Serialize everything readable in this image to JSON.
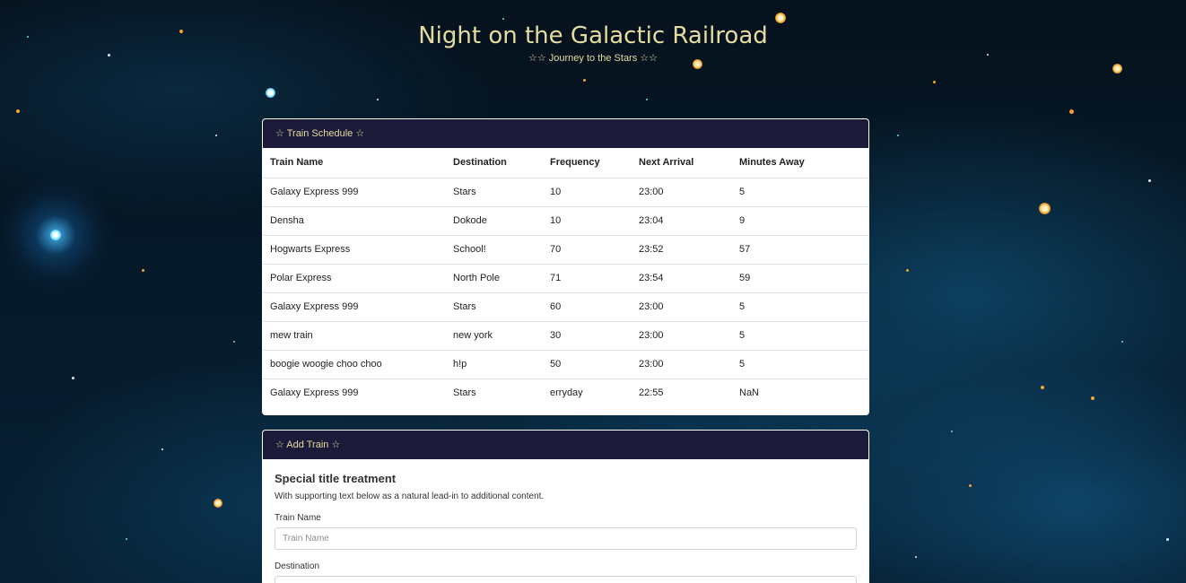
{
  "header": {
    "title": "Night on the Galactic Railroad",
    "subtitle": "☆☆ Journey to the Stars ☆☆"
  },
  "schedule": {
    "header": "☆ Train Schedule ☆",
    "columns": [
      "Train Name",
      "Destination",
      "Frequency",
      "Next Arrival",
      "Minutes Away"
    ],
    "rows": [
      [
        "Galaxy Express 999",
        "Stars",
        "10",
        "23:00",
        "5"
      ],
      [
        "Densha",
        "Dokode",
        "10",
        "23:04",
        "9"
      ],
      [
        "Hogwarts Express",
        "School!",
        "70",
        "23:52",
        "57"
      ],
      [
        "Polar Express",
        "North Pole",
        "71",
        "23:54",
        "59"
      ],
      [
        "Galaxy Express 999",
        "Stars",
        "60",
        "23:00",
        "5"
      ],
      [
        "mew train",
        "new york",
        "30",
        "23:00",
        "5"
      ],
      [
        "boogie woogie choo choo",
        "h!p",
        "50",
        "23:00",
        "5"
      ],
      [
        "Galaxy Express 999",
        "Stars",
        "erryday",
        "22:55",
        "NaN"
      ]
    ]
  },
  "add_train": {
    "header": "☆ Add Train ☆",
    "title": "Special title treatment",
    "text": "With supporting text below as a natural lead-in to additional content.",
    "train_name_label": "Train Name",
    "train_name_placeholder": "Train Name",
    "train_name_value": "",
    "destination_label": "Destination",
    "destination_placeholder": "",
    "destination_value": ""
  },
  "colors": {
    "accent": "#e5dca0",
    "card_header_bg": "#1b1a39",
    "background": "#061a2a"
  }
}
